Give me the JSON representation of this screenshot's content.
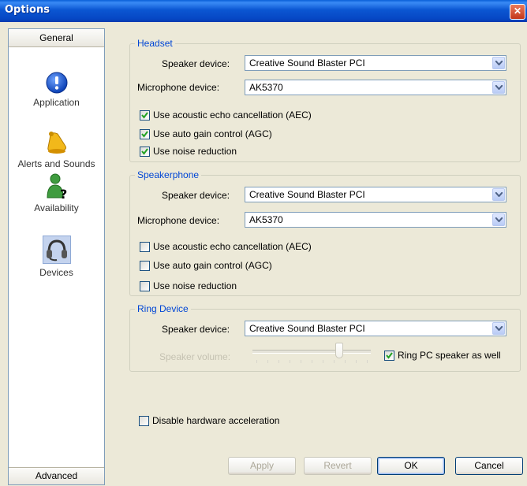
{
  "window": {
    "title": "Options",
    "close_icon": "close-icon"
  },
  "sidebar": {
    "top_button": "General",
    "bottom_button": "Advanced",
    "items": [
      {
        "label": "Application",
        "icon": "info-icon"
      },
      {
        "label": "Alerts and Sounds",
        "icon": "bell-icon"
      },
      {
        "label": "Availability",
        "icon": "user-question-icon"
      },
      {
        "label": "Devices",
        "icon": "headset-icon"
      }
    ]
  },
  "headset": {
    "title": "Headset",
    "speaker_label": "Speaker device:",
    "speaker_value": "Creative Sound Blaster PCI",
    "mic_label": "Microphone device:",
    "mic_value": "AK5370",
    "aec_label": "Use acoustic echo cancellation (AEC)",
    "aec_checked": true,
    "agc_label": "Use auto gain control (AGC)",
    "agc_checked": true,
    "noise_label": "Use noise reduction",
    "noise_checked": true
  },
  "speakerphone": {
    "title": "Speakerphone",
    "speaker_label": "Speaker device:",
    "speaker_value": "Creative Sound Blaster PCI",
    "mic_label": "Microphone device:",
    "mic_value": "AK5370",
    "aec_label": "Use acoustic echo cancellation (AEC)",
    "aec_checked": false,
    "agc_label": "Use auto gain control (AGC)",
    "agc_checked": false,
    "noise_label": "Use noise reduction",
    "noise_checked": false
  },
  "ring": {
    "title": "Ring Device",
    "speaker_label": "Speaker device:",
    "speaker_value": "Creative Sound Blaster PCI",
    "volume_label": "Speaker volume:",
    "volume_level": 0.75,
    "ring_pc_label": "Ring PC speaker as well",
    "ring_pc_checked": true
  },
  "hw_accel": {
    "label": "Disable hardware acceleration",
    "checked": false
  },
  "buttons": {
    "apply": "Apply",
    "revert": "Revert",
    "ok": "OK",
    "cancel": "Cancel"
  },
  "colors": {
    "titlebar": "#0b56d2",
    "group_title": "#0046d5",
    "check": "#21a121"
  }
}
